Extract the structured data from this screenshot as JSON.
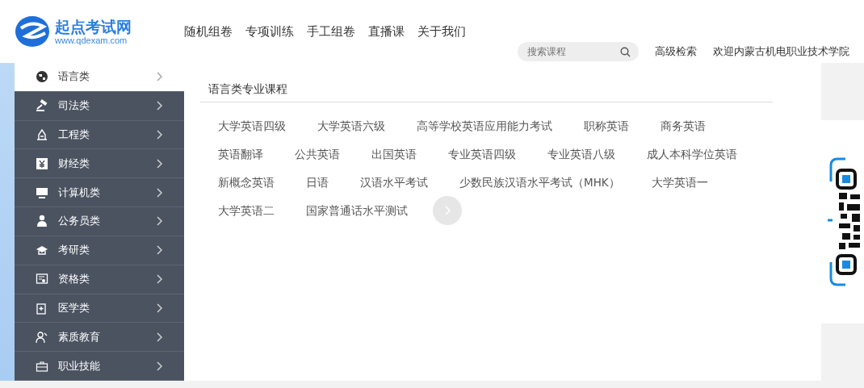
{
  "logo": {
    "title": "起点考试网",
    "url": "www.qdexam.com"
  },
  "nav": [
    "随机组卷",
    "专项训练",
    "手工组卷",
    "直播课",
    "关于我们"
  ],
  "search": {
    "placeholder": "搜索课程"
  },
  "advanced_search": "高级检索",
  "welcome": "欢迎内蒙古机电职业技术学院",
  "sidebar": {
    "items": [
      {
        "label": "语言类",
        "selected": true
      },
      {
        "label": "司法类",
        "selected": false
      },
      {
        "label": "工程类",
        "selected": false
      },
      {
        "label": "财经类",
        "selected": false
      },
      {
        "label": "计算机类",
        "selected": false
      },
      {
        "label": "公务员类",
        "selected": false
      },
      {
        "label": "考研类",
        "selected": false
      },
      {
        "label": "资格类",
        "selected": false
      },
      {
        "label": "医学类",
        "selected": false
      },
      {
        "label": "素质教育",
        "selected": false
      },
      {
        "label": "职业技能",
        "selected": false
      }
    ]
  },
  "panel": {
    "title": "语言类专业课程",
    "courses": [
      "大学英语四级",
      "大学英语六级",
      "高等学校英语应用能力考试",
      "职称英语",
      "商务英语",
      "英语翻译",
      "公共英语",
      "出国英语",
      "专业英语四级",
      "专业英语八级",
      "成人本科学位英语",
      "新概念英语",
      "日语",
      "汉语水平考试",
      "少数民族汉语水平考试（MHK）",
      "大学英语一",
      "大学英语二",
      "国家普通话水平测试"
    ]
  }
}
